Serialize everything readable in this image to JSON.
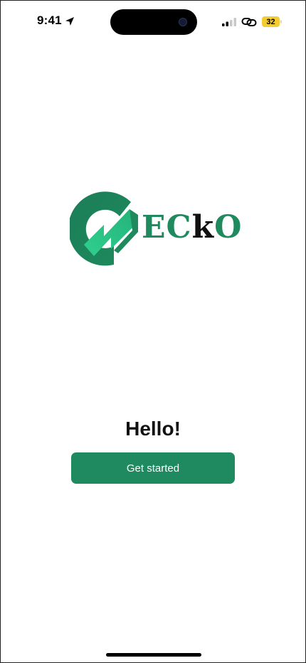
{
  "status_bar": {
    "time": "9:41",
    "location_icon": "location-arrow-icon",
    "signal_icon": "cellular-signal-icon",
    "link_icon": "link-icon",
    "battery_level": "32",
    "battery_color": "#f2cc33"
  },
  "logo": {
    "text_part1": "EC",
    "text_part2": "k",
    "text_part3": "O",
    "brand_color": "#1f8a5e",
    "accent_color": "#2fd08f"
  },
  "main": {
    "greeting": "Hello!",
    "cta_label": "Get started",
    "cta_color": "#1f8a5f"
  }
}
